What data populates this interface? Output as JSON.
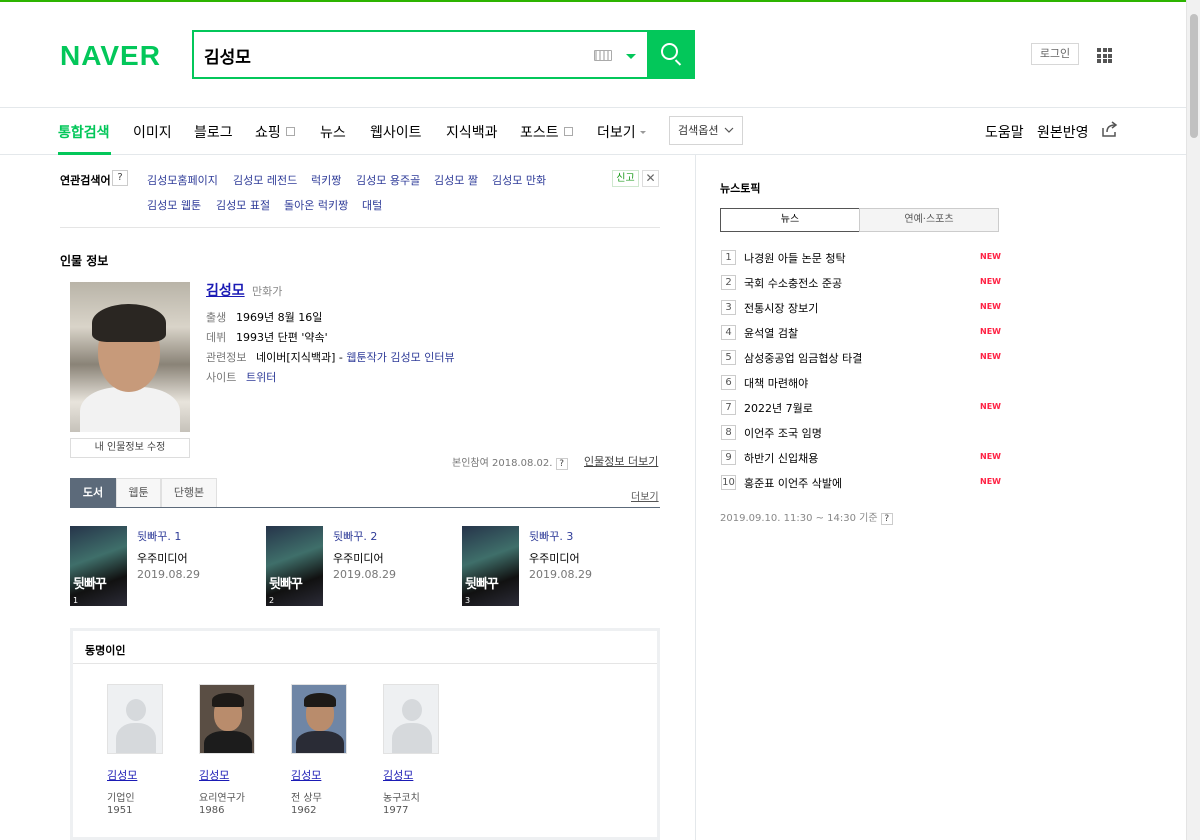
{
  "header": {
    "logo": "NAVER",
    "search_value": "김성모",
    "login_label": "로그인"
  },
  "nav": {
    "tabs": [
      "통합검색",
      "이미지",
      "블로그",
      "쇼핑",
      "뉴스",
      "웹사이트",
      "지식백과",
      "포스트",
      "더보기"
    ],
    "search_option": "검색옵션",
    "help": "도움말",
    "original": "원본반영"
  },
  "related": {
    "label": "연관검색어",
    "help": "?",
    "terms": [
      "김성모홈페이지",
      "김성모 레전드",
      "럭키짱",
      "김성모 용주골",
      "김성모 짤",
      "김성모 만화",
      "김성모 웹툰",
      "김성모 표절",
      "돌아온 럭키짱",
      "대털"
    ],
    "report": "신고",
    "close": "✕"
  },
  "person": {
    "section_title": "인물 정보",
    "name": "김성모",
    "job": "만화가",
    "birth_key": "출생",
    "birth_val": "1969년 8월 16일",
    "debut_key": "데뷔",
    "debut_val": "1993년 단편 '약속'",
    "related_key": "관련정보",
    "related_val_prefix": "네이버[지식백과] - ",
    "related_val_link": "웹툰작가 김성모 인터뷰",
    "site_key": "사이트",
    "site_val": "트위터",
    "edit_btn": "내 인물정보 수정",
    "verified": "본인참여 2018.08.02.",
    "more": "인물정보 더보기"
  },
  "books": {
    "tabs": [
      "도서",
      "웹툰",
      "단행본"
    ],
    "more": "더보기",
    "items": [
      {
        "title": "뒷빠꾸. 1",
        "publisher": "우주미디어",
        "date": "2019.08.29",
        "cover_title": "뒷빠꾸",
        "cover_num": "1"
      },
      {
        "title": "뒷빠꾸. 2",
        "publisher": "우주미디어",
        "date": "2019.08.29",
        "cover_title": "뒷빠꾸",
        "cover_num": "2"
      },
      {
        "title": "뒷빠꾸. 3",
        "publisher": "우주미디어",
        "date": "2019.08.29",
        "cover_title": "뒷빠꾸",
        "cover_num": "3"
      }
    ]
  },
  "namesakes": {
    "title": "동명이인",
    "items": [
      {
        "name": "김성모",
        "role": "기업인",
        "year": "1951"
      },
      {
        "name": "김성모",
        "role": "요리연구가",
        "year": "1986"
      },
      {
        "name": "김성모",
        "role": "전 상무",
        "year": "1962"
      },
      {
        "name": "김성모",
        "role": "농구코치",
        "year": "1977"
      }
    ]
  },
  "news_topic": {
    "title": "뉴스토픽",
    "tabs": [
      "뉴스",
      "연예·스포츠"
    ],
    "new_label": "NEW",
    "items": [
      {
        "num": "1",
        "text": "나경원 아들 논문 청탁",
        "is_new": true
      },
      {
        "num": "2",
        "text": "국회 수소충전소 준공",
        "is_new": true
      },
      {
        "num": "3",
        "text": "전통시장 장보기",
        "is_new": true
      },
      {
        "num": "4",
        "text": "윤석열 검찰",
        "is_new": true
      },
      {
        "num": "5",
        "text": "삼성중공업 임금협상 타결",
        "is_new": true
      },
      {
        "num": "6",
        "text": "대책 마련해야",
        "is_new": false
      },
      {
        "num": "7",
        "text": "2022년 7월로",
        "is_new": true
      },
      {
        "num": "8",
        "text": "이언주 조국 임명",
        "is_new": false
      },
      {
        "num": "9",
        "text": "하반기 신입채용",
        "is_new": true
      },
      {
        "num": "10",
        "text": "홍준표 이언주 삭발에",
        "is_new": true
      }
    ],
    "footer": "2019.09.10. 11:30 ~ 14:30 기준"
  },
  "colors": {
    "brand_green": "#03c75a",
    "link_blue": "#2e3b98",
    "new_red": "#ff2244"
  }
}
